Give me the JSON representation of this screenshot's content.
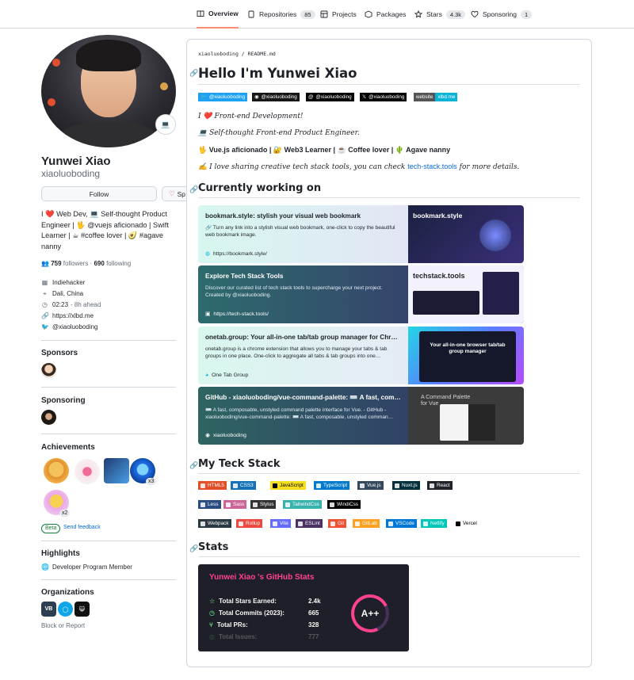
{
  "nav": {
    "tabs": [
      {
        "label": "Overview",
        "count": ""
      },
      {
        "label": "Repositories",
        "count": "85"
      },
      {
        "label": "Projects",
        "count": ""
      },
      {
        "label": "Packages",
        "count": ""
      },
      {
        "label": "Stars",
        "count": "4.3k"
      },
      {
        "label": "Sponsoring",
        "count": "1"
      }
    ]
  },
  "profile": {
    "fullname": "Yunwei Xiao",
    "login": "xiaoluoboding",
    "follow_label": "Follow",
    "sponsor_label": "Sp",
    "bio": "I ❤️ Web Dev, 💻 Self-thought Product Engineer | 🖖 @vuejs aficionado | Swift Learner | ☕ #coffee lover | 🥑 #agave nanny",
    "followers": "759",
    "followers_label": "followers",
    "following": "690",
    "following_label": "following",
    "company": "Indiehacker",
    "location": "Dali, China",
    "time": "02:23",
    "time_note": "- 8h ahead",
    "website": "https://xlbd.me",
    "twitter": "@xiaoluoboding",
    "avatar_emoji": "💻"
  },
  "sidebar": {
    "sponsors_title": "Sponsors",
    "sponsoring_title": "Sponsoring",
    "achievements_title": "Achievements",
    "achievement_counts": [
      "x3",
      "x2"
    ],
    "beta_label": "Beta",
    "feedback_label": "Send feedback",
    "highlights_title": "Highlights",
    "highlight_item": "Developer Program Member",
    "organizations_title": "Organizations",
    "block_label": "Block or Report"
  },
  "readme": {
    "crumb_user": "xiaoluoboding",
    "crumb_file": "README.md",
    "title": "Hello I'm Yunwei Xiao",
    "social_badges": [
      {
        "icon": "twitter",
        "label": "@xiaoluoboding",
        "color": "#1da1f2"
      },
      {
        "icon": "github",
        "label": "@xiaoluoboding",
        "color": "#181717"
      },
      {
        "icon": "threads",
        "label": "@xiaoluoboding",
        "color": "#000000"
      },
      {
        "icon": "x",
        "label": "@xiaoluoboding",
        "color": "#000000"
      },
      {
        "icon": "website",
        "label": "website",
        "value": "xlbd.me",
        "color": "#555555",
        "value_color": "#0bb3d6"
      }
    ],
    "intro": [
      "I ❤️ Front-end Development!",
      "💻 Self-thought Front-end Product Engineer.",
      "🖖 Vue.js aficionado | 🔐 Web3 Learner | ☕ Coffee lover | 🌵 Agave nanny",
      "✍️ I love sharing creative tech stack tools, you can check"
    ],
    "intro_link": "tech-stack.tools",
    "intro_tail": "for more details.",
    "working_title": "Currently working on",
    "cards": [
      {
        "title": "bookmark.style: stylish your visual web bookmark",
        "desc": "🔗 Turn any link into a stylish visual web bookmark, one-click to copy the beautiful web bookmark image.",
        "url": "https://bookmark.style/",
        "img_label": "bookmark.style"
      },
      {
        "title": "Explore Tech Stack Tools",
        "desc": "Discover our curated list of tech stack tools to supercharge your next project. Created by @xiaoluoboding.",
        "url": "https://tech-stack.tools/",
        "img_label": "techstack.tools"
      },
      {
        "title": "onetab.group: Your all-in-one tab/tab group manager for Chro…",
        "desc": "onetab.group is a chrome extension that allows you to manage your tabs & tab groups in one place. One-click to aggregate all tabs & tab groups into one…",
        "url": "One Tab Group",
        "img_label": "Your all-in-one browser tab/tab group manager"
      },
      {
        "title": "GitHub - xiaoluoboding/vue-command-palette: ⌨️ A fast, comp…",
        "desc": "⌨️ A fast, composable, unstyled command palette interface for Vue. - GitHub - xiaoluoboding/vue-command-palette: ⌨️ A fast, composable, unstyled comman…",
        "url": "xiaoluoboding",
        "img_label": "A Command Palette for Vue"
      }
    ],
    "stack_title": "My Teck Stack",
    "tech_row1": [
      {
        "label": "HTML5",
        "color": "#e34f26"
      },
      {
        "label": "CSS3",
        "color": "#1572b6"
      },
      {
        "label": "JavaScript",
        "color": "#f7df1e",
        "text": "#000000"
      },
      {
        "label": "TypeScript",
        "color": "#007acc"
      },
      {
        "label": "Vue.js",
        "color": "#35495e"
      },
      {
        "label": "Nuxt.js",
        "color": "#002e3b"
      },
      {
        "label": "React",
        "color": "#20232a"
      }
    ],
    "tech_row2": [
      {
        "label": "Less",
        "color": "#2b4c80"
      },
      {
        "label": "Sass",
        "color": "#cc6699"
      },
      {
        "label": "Stylus",
        "color": "#333333"
      },
      {
        "label": "TailwindCss",
        "color": "#38b2ac"
      },
      {
        "label": "WindiCss",
        "color": "#000000"
      }
    ],
    "tech_row3": [
      {
        "label": "Webpack",
        "color": "#2b3a42"
      },
      {
        "label": "Rollup",
        "color": "#ec4a3f"
      },
      {
        "label": "Vite",
        "color": "#646cff"
      },
      {
        "label": "ESLint",
        "color": "#4b3263"
      },
      {
        "label": "Git",
        "color": "#f05033"
      },
      {
        "label": "GitLab",
        "color": "#fca121"
      },
      {
        "label": "VSCode",
        "color": "#0078d7"
      },
      {
        "label": "Netlify",
        "color": "#00c7b7"
      },
      {
        "label": "Vercel",
        "color": "#ffffff",
        "text": "#000000"
      }
    ],
    "stats_title": "Stats",
    "stats_card": {
      "title": "Yunwei Xiao 's GitHub Stats",
      "rows": [
        {
          "icon": "star",
          "label": "Total Stars Earned:",
          "value": "2.4k"
        },
        {
          "icon": "clock",
          "label": "Total Commits (2023):",
          "value": "665"
        },
        {
          "icon": "pr",
          "label": "Total PRs:",
          "value": "328"
        },
        {
          "icon": "issue",
          "label": "Total Issues:",
          "value": "777"
        }
      ],
      "grade": "A++",
      "accent": "#fe428e",
      "bg": "#1e1f29"
    }
  }
}
